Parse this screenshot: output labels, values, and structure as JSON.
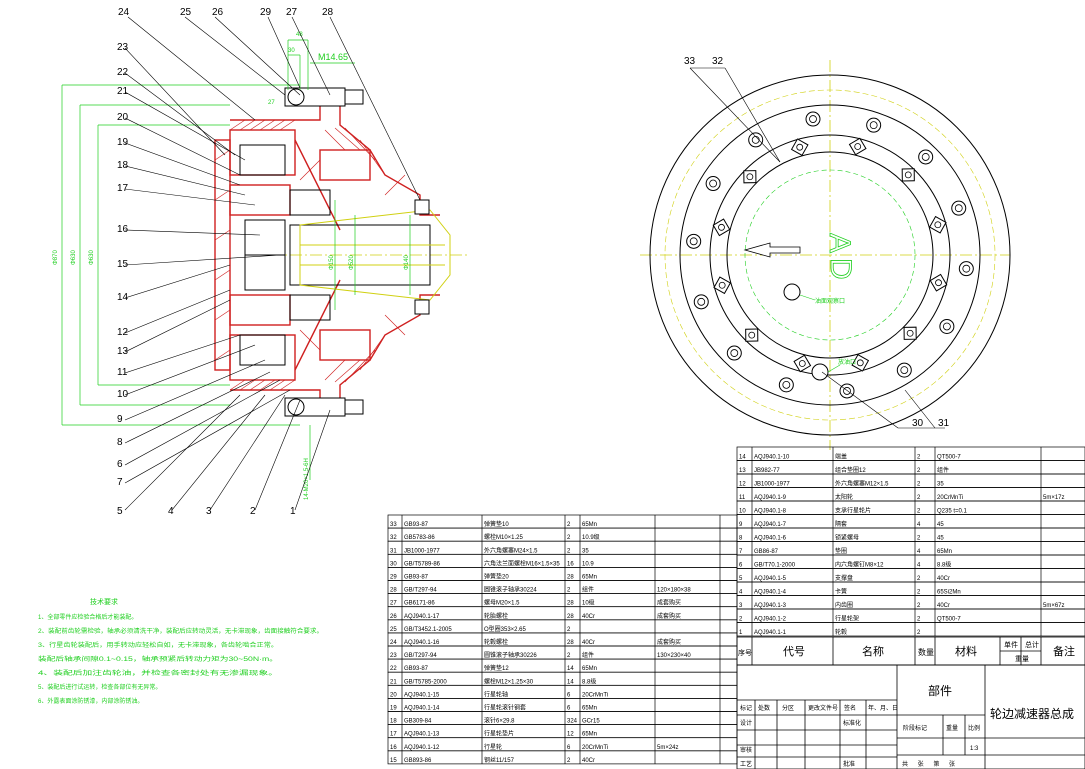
{
  "drawing": {
    "title": "轮边减速器总成",
    "part_label": "部件",
    "scale": "1:3",
    "sheet_line": "共  张  第  张"
  },
  "callouts_left": [
    "24",
    "25",
    "26",
    "29",
    "27",
    "28",
    "23",
    "22",
    "21",
    "20",
    "19",
    "18",
    "17",
    "16",
    "15",
    "14",
    "12",
    "13",
    "11",
    "10",
    "9",
    "8",
    "6",
    "7",
    "5",
    "4",
    "3",
    "2",
    "1"
  ],
  "callouts_right": [
    "33",
    "32",
    "30",
    "31"
  ],
  "dimensions": {
    "top_small": [
      "48",
      "30",
      "M14.65",
      "27"
    ],
    "left_vertical": [
      "Φ870",
      "Φ630",
      "Φ630"
    ],
    "center": [
      "Φ150",
      "Φ520",
      "Φ140"
    ],
    "bottom": "14-M20×1.5-6H",
    "center_marks": [
      "A",
      "D"
    ],
    "port_labels": [
      "油面观察口",
      "放油口"
    ]
  },
  "tech_requirements": {
    "title": "技术要求",
    "items": [
      "1、全部零件应检验合格后才能装配。",
      "2、装配前齿轮需检验，轴承必须清洗干净，装配后应转动灵活，无卡滞现象，齿面接触符合要求。",
      "3、行星齿轮装配后，用手转动应轻松自如，无卡滞现象，各齿轮啮合正常。",
      "装配后轴承间隙0.1~0.15，轴承预紧后转动力矩为30~50N·m。",
      "4、装配后加注齿轮油，并检查各密封处有无渗漏现象。",
      "5、装配后进行试运转，检查各部位有无异常。",
      "6、外露表面涂防锈漆，内部涂防锈油。"
    ]
  },
  "bom_upper": [
    {
      "no": "14",
      "code": "AQJ940.1-10",
      "name": "端盖",
      "qty": "2",
      "mat": "QT500-7",
      "note": ""
    },
    {
      "no": "13",
      "code": "JB982-77",
      "name": "组合垫圈12",
      "qty": "2",
      "mat": "组件",
      "note": ""
    },
    {
      "no": "12",
      "code": "JB1000-1977",
      "name": "外六角螺塞M12×1.5",
      "qty": "2",
      "mat": "35",
      "note": ""
    },
    {
      "no": "11",
      "code": "AQJ940.1-9",
      "name": "太阳轮",
      "qty": "2",
      "mat": "20CrMnTi",
      "note": "5m×17z"
    },
    {
      "no": "10",
      "code": "AQJ940.1-8",
      "name": "支承行星轮片",
      "qty": "2",
      "mat": "Q235 t=0.1",
      "note": ""
    },
    {
      "no": "9",
      "code": "AQJ940.1-7",
      "name": "隔套",
      "qty": "4",
      "mat": "45",
      "note": ""
    },
    {
      "no": "8",
      "code": "AQJ940.1-6",
      "name": "锁紧螺母",
      "qty": "2",
      "mat": "45",
      "note": ""
    },
    {
      "no": "7",
      "code": "GB86-87",
      "name": "垫圈",
      "qty": "4",
      "mat": "65Mn",
      "note": ""
    },
    {
      "no": "6",
      "code": "GB/T70.1-2000",
      "name": "内六角螺钉M8×12",
      "qty": "4",
      "mat": "8.8级",
      "note": ""
    },
    {
      "no": "5",
      "code": "AQJ940.1-5",
      "name": "支撑盘",
      "qty": "2",
      "mat": "40Cr",
      "note": ""
    },
    {
      "no": "4",
      "code": "AQJ940.1-4",
      "name": "卡簧",
      "qty": "2",
      "mat": "65Si2Mn",
      "note": ""
    },
    {
      "no": "3",
      "code": "AQJ940.1-3",
      "name": "内齿圈",
      "qty": "2",
      "mat": "40Cr",
      "note": "5m×67z"
    },
    {
      "no": "2",
      "code": "AQJ940.1-2",
      "name": "行星轮架",
      "qty": "2",
      "mat": "QT500-7",
      "note": ""
    },
    {
      "no": "1",
      "code": "AQJ940.1-1",
      "name": "轮毂",
      "qty": "2",
      "mat": "",
      "note": ""
    }
  ],
  "bom_lower": [
    {
      "no": "33",
      "code": "GB93-87",
      "name": "弹簧垫10",
      "qty": "2",
      "mat": "65Mn",
      "note": ""
    },
    {
      "no": "32",
      "code": "GB5783-86",
      "name": "螺栓M10×1.25",
      "qty": "2",
      "mat": "10.9级",
      "note": ""
    },
    {
      "no": "31",
      "code": "JB1000-1977",
      "name": "外六角螺塞M24×1.5",
      "qty": "2",
      "mat": "35",
      "note": ""
    },
    {
      "no": "30",
      "code": "GB/T5789-86",
      "name": "六角法兰面螺栓M16×1.5×35",
      "qty": "16",
      "mat": "10.9",
      "note": ""
    },
    {
      "no": "29",
      "code": "GB93-87",
      "name": "弹簧垫20",
      "qty": "28",
      "mat": "65Mn",
      "note": ""
    },
    {
      "no": "28",
      "code": "GB/T297-94",
      "name": "圆锥滚子轴承30224",
      "qty": "2",
      "mat": "组件",
      "note": "120×180×38"
    },
    {
      "no": "27",
      "code": "GB6171-86",
      "name": "螺母M20×1.5",
      "qty": "28",
      "mat": "10级",
      "note": "成套购买"
    },
    {
      "no": "26",
      "code": "AQJ940.1-17",
      "name": "轮胎螺栓",
      "qty": "28",
      "mat": "40Cr",
      "note": "成套购买"
    },
    {
      "no": "25",
      "code": "GB/T3452.1-2005",
      "name": "O型圈353×2.65",
      "qty": "2",
      "mat": "",
      "note": ""
    },
    {
      "no": "24",
      "code": "AQJ940.1-16",
      "name": "轮毂螺栓",
      "qty": "28",
      "mat": "40Cr",
      "note": "成套购买"
    },
    {
      "no": "23",
      "code": "GB/T297-94",
      "name": "圆锥滚子轴承30226",
      "qty": "2",
      "mat": "组件",
      "note": "130×230×40"
    },
    {
      "no": "22",
      "code": "GB93-87",
      "name": "弹簧垫12",
      "qty": "14",
      "mat": "65Mn",
      "note": ""
    },
    {
      "no": "21",
      "code": "GB/T5785-2000",
      "name": "螺栓M12×1.25×30",
      "qty": "14",
      "mat": "8.8级",
      "note": ""
    },
    {
      "no": "20",
      "code": "AQJ940.1-15",
      "name": "行星轮轴",
      "qty": "6",
      "mat": "20CrMnTi",
      "note": ""
    },
    {
      "no": "19",
      "code": "AQJ940.1-14",
      "name": "行星轮滚针钢套",
      "qty": "6",
      "mat": "65Mn",
      "note": ""
    },
    {
      "no": "18",
      "code": "GB309-84",
      "name": "滚针6×29.8",
      "qty": "324",
      "mat": "GCr15",
      "note": ""
    },
    {
      "no": "17",
      "code": "AQJ940.1-13",
      "name": "行星轮垫片",
      "qty": "12",
      "mat": "65Mn",
      "note": ""
    },
    {
      "no": "16",
      "code": "AQJ940.1-12",
      "name": "行星轮",
      "qty": "6",
      "mat": "20CrMnTi",
      "note": "5m×24z"
    },
    {
      "no": "15",
      "code": "GB893-86",
      "name": "钢丝11/157",
      "qty": "2",
      "mat": "40Cr",
      "note": ""
    }
  ],
  "bom_header": {
    "no": "序号",
    "code": "代号",
    "name": "名称",
    "qty": "数量",
    "mat": "材料",
    "unit_weight": "单件",
    "total_weight": "总计",
    "weight": "重量",
    "note": "备注"
  },
  "title_block": {
    "row1": [
      "标记",
      "处数",
      "分区",
      "更改文件号",
      "签名",
      "年、月、日"
    ],
    "design": "设计",
    "std": "标准化",
    "stage": "阶段标记",
    "weight": "重量",
    "ratio": "比例",
    "review": "审核",
    "process": "工艺",
    "approve": "批准"
  },
  "colors": {
    "line": "#000000",
    "dim": "#1fcf1f",
    "section": "#cf2020",
    "center": "#d0d010",
    "hub": "#202020"
  }
}
